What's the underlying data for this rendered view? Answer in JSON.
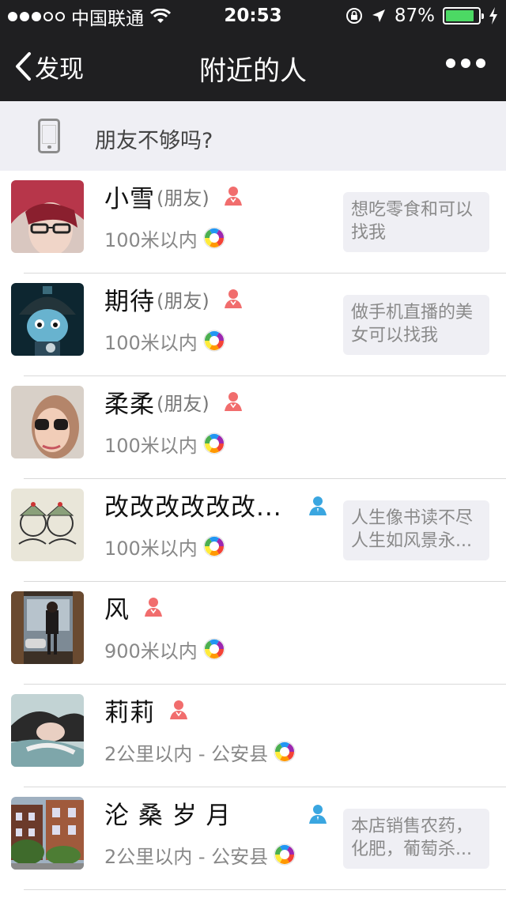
{
  "status_bar": {
    "carrier": "中国联通",
    "time": "20:53",
    "battery_percent": "87%",
    "battery_level": 0.87
  },
  "nav": {
    "back_label": "发现",
    "title": "附近的人"
  },
  "banner": {
    "text": "朋友不够吗?"
  },
  "people": [
    {
      "name": "小雪",
      "tag": "(朋友)",
      "gender": "female",
      "distance": "100米以内",
      "signature": "想吃零食和可以找我"
    },
    {
      "name": "期待",
      "tag": "(朋友)",
      "gender": "female",
      "distance": "100米以内",
      "signature": "做手机直播的美女可以找我"
    },
    {
      "name": "柔柔",
      "tag": "(朋友)",
      "gender": "female",
      "distance": "100米以内",
      "signature": ""
    },
    {
      "name": "改改改改改改...",
      "tag": "",
      "gender": "male",
      "distance": "100米以内",
      "signature": "人生像书读不尽人生如风景永..."
    },
    {
      "name": "风",
      "tag": "",
      "gender": "female",
      "distance": "900米以内",
      "signature": ""
    },
    {
      "name": "莉莉",
      "tag": "",
      "gender": "female",
      "distance": "2公里以内 - 公安县",
      "signature": ""
    },
    {
      "name": "沦 桑 岁 月",
      "tag": "",
      "gender": "male",
      "distance": "2公里以内 - 公安县",
      "signature": "本店销售农药，化肥，葡萄杀..."
    }
  ],
  "colors": {
    "bar": "#1f1f21",
    "banner_bg": "#efeff4",
    "female": "#f16d6d",
    "male": "#3aa6e0"
  }
}
